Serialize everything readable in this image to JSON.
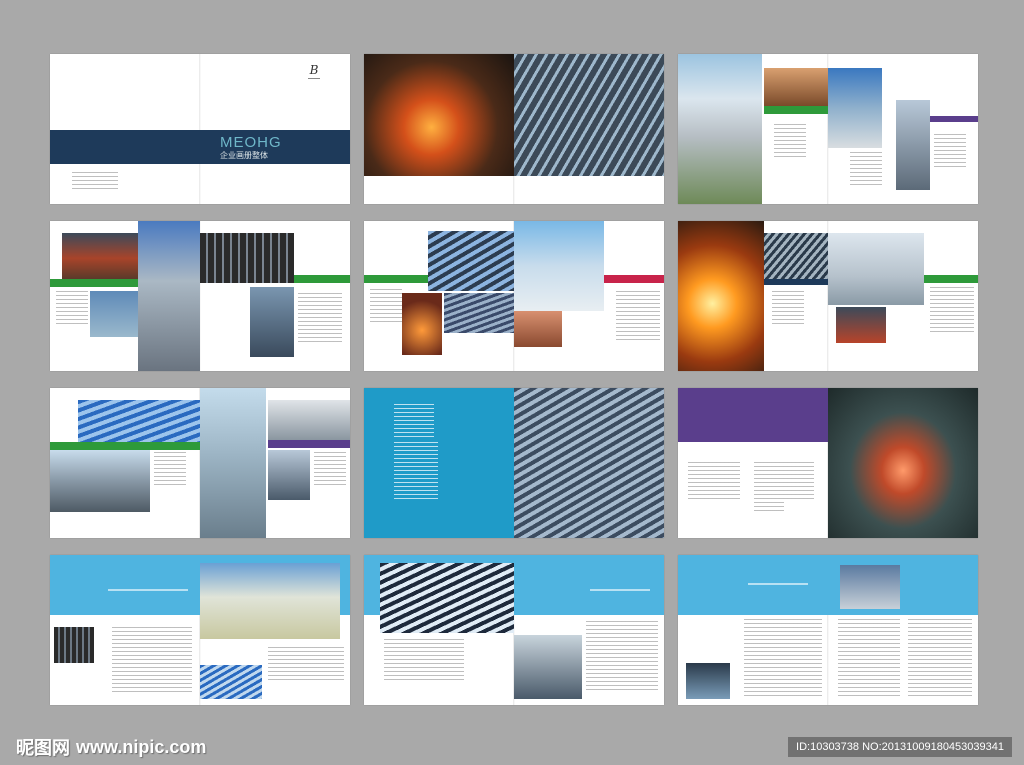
{
  "brochure": {
    "cover": {
      "brand": "MEOHG",
      "subtitle": "企业画册整体"
    }
  },
  "watermark": {
    "site_cn": "昵图网",
    "site_url": "www.nipic.com",
    "id_text": "ID:10303738 NO:20131009180453039341"
  },
  "colors": {
    "background": "#a9a9a9",
    "navy": "#1e3a5a",
    "green": "#2e9a3a",
    "purple": "#5a3e8c",
    "teal": "#1f9bc8",
    "sky": "#4fb4e0",
    "crimson": "#c8234a"
  }
}
